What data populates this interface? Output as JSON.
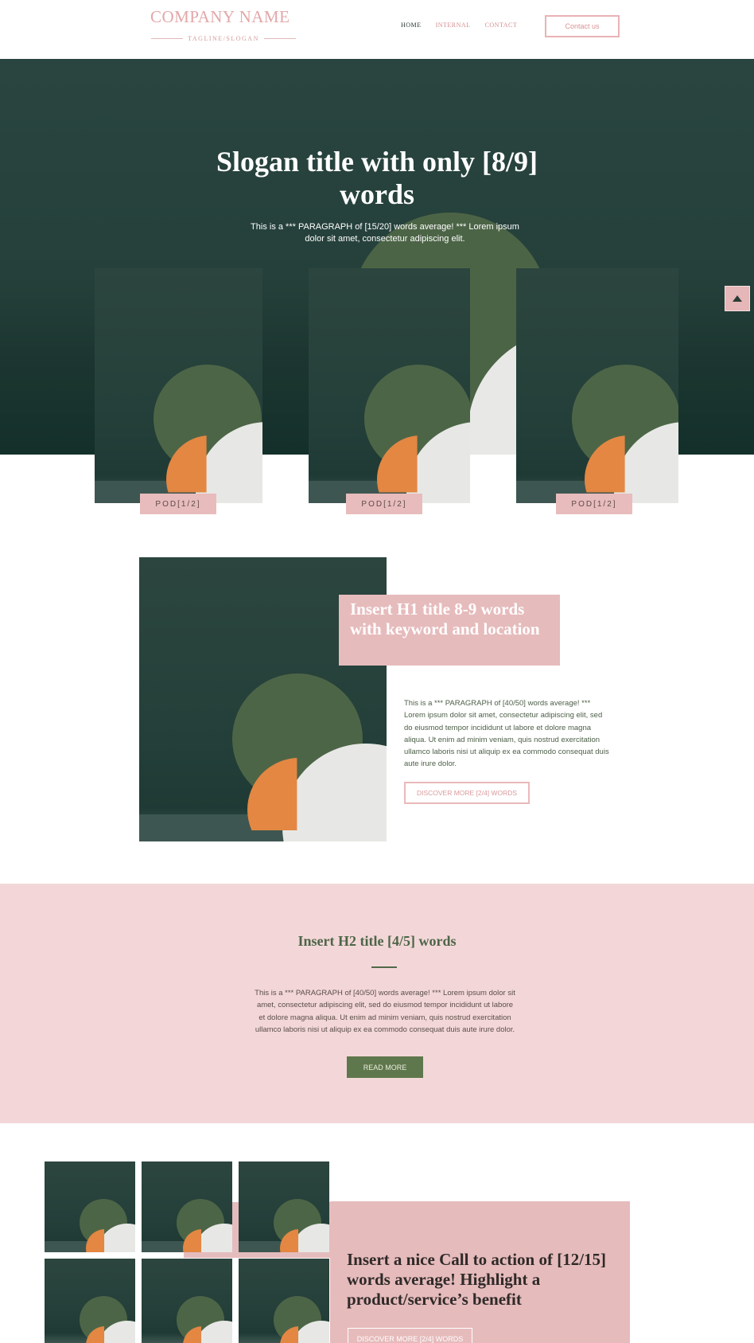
{
  "header": {
    "company_name": "COMPANY NAME",
    "tagline": "TAGLINE/SLOGAN",
    "nav": [
      "HOME",
      "INTERNAL",
      "CONTACT"
    ],
    "contact_button": "Contact us"
  },
  "hero": {
    "title": "Slogan title with only [8/9] words",
    "paragraph": "This is a *** PARAGRAPH of [15/20] words average! *** Lorem ipsum dolor sit amet, consectetur adipiscing elit."
  },
  "products": [
    {
      "label": "POD[1/2]"
    },
    {
      "label": "POD[1/2]"
    },
    {
      "label": "POD[1/2]"
    }
  ],
  "feature": {
    "title": "Insert H1 title 8-9 words with keyword and location",
    "paragraph": "This is a *** PARAGRAPH of [40/50] words average! *** Lorem ipsum dolor sit amet, consectetur adipiscing elit, sed do eiusmod tempor incididunt ut labore et dolore magna aliqua. Ut enim ad minim veniam, quis nostrud exercitation ullamco laboris nisi ut aliquip ex ea commodo consequat duis aute irure dolor.",
    "button": "DISCOVER MORE [2/4] WORDS"
  },
  "band": {
    "title": "Insert H2 title [4/5] words",
    "paragraph": "This is a *** PARAGRAPH of [40/50] words average! *** Lorem ipsum dolor sit amet, consectetur adipiscing elit, sed do eiusmod tempor incididunt ut labore et dolore magna aliqua. Ut enim ad minim veniam, quis nostrud exercitation ullamco laboris nisi ut aliquip ex ea commodo consequat duis aute irure dolor.",
    "button": "READ MORE"
  },
  "cta": {
    "title": "Insert a nice Call to action of [12/15] words average! Highlight a product/service’s benefit",
    "button": "DISCOVER MORE [2/4] WORDS"
  },
  "colors": {
    "accent_pink": "#e6bbbc",
    "dark_green": "#25403a",
    "olive": "#5f774c"
  }
}
